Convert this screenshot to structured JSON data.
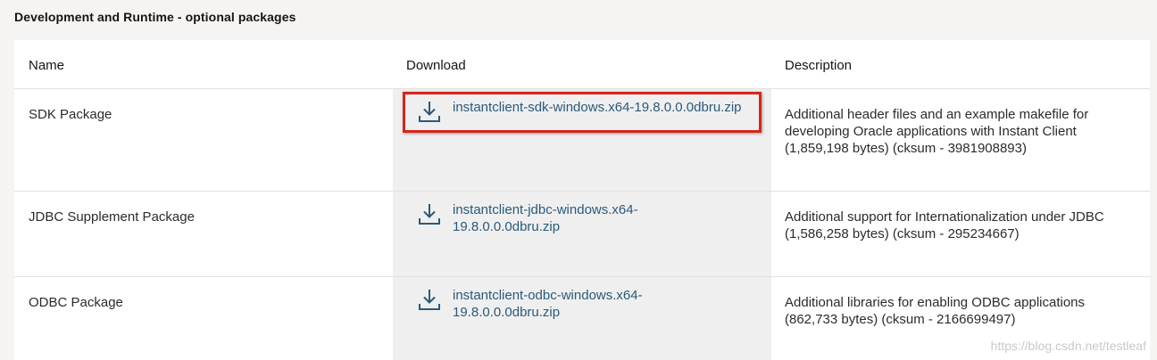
{
  "section": {
    "title": "Development and Runtime - optional packages"
  },
  "table": {
    "headers": {
      "name": "Name",
      "download": "Download",
      "description": "Description"
    },
    "rows": [
      {
        "name": "SDK Package",
        "download_line1": "instantclient-sdk-windows.x64-19.8.0.0.0dbru.zip",
        "download_line2": "",
        "description": "Additional header files and an example makefile for developing Oracle applications with Instant Client (1,859,198 bytes) (cksum - 3981908893)"
      },
      {
        "name": "JDBC Supplement Package",
        "download_line1": "instantclient-jdbc-windows.x64-",
        "download_line2": "19.8.0.0.0dbru.zip",
        "description": "Additional support for Internationalization under JDBC (1,586,258 bytes) (cksum - 295234667)"
      },
      {
        "name": "ODBC Package",
        "download_line1": "instantclient-odbc-windows.x64-",
        "download_line2": "19.8.0.0.0dbru.zip",
        "description": "Additional libraries for enabling ODBC applications (862,733 bytes) (cksum - 2166699497)"
      }
    ]
  },
  "watermark": "https://blog.csdn.net/testleaf",
  "colors": {
    "link": "#2a5a7a",
    "highlight": "#d8241c",
    "download_column_bg": "#efefef"
  },
  "icons": {
    "download": "download-icon"
  }
}
